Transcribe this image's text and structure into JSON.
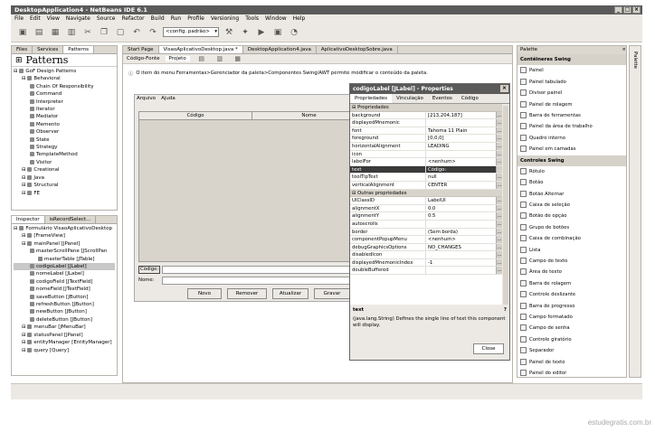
{
  "window": {
    "title": "DesktopApplication4 - NetBeans IDE 6.1",
    "controls": [
      "_",
      "□",
      "×"
    ]
  },
  "menu": [
    "File",
    "Edit",
    "View",
    "Navigate",
    "Source",
    "Refactor",
    "Build",
    "Run",
    "Profile",
    "Versioning",
    "Tools",
    "Window",
    "Help"
  ],
  "toolbar": {
    "config": "<config. padrão>"
  },
  "left_top": {
    "tabs": [
      "Files",
      "Services",
      "Patterns"
    ],
    "header": "Patterns",
    "tree": [
      {
        "t": "GoF Design Patterns",
        "d": 0
      },
      {
        "t": "Behavioral",
        "d": 1
      },
      {
        "t": "Chain Of Responsibility",
        "d": 2
      },
      {
        "t": "Command",
        "d": 2
      },
      {
        "t": "Interpreter",
        "d": 2
      },
      {
        "t": "Iterator",
        "d": 2
      },
      {
        "t": "Mediator",
        "d": 2
      },
      {
        "t": "Memento",
        "d": 2
      },
      {
        "t": "Observer",
        "d": 2
      },
      {
        "t": "State",
        "d": 2
      },
      {
        "t": "Strategy",
        "d": 2
      },
      {
        "t": "TemplateMethod",
        "d": 2
      },
      {
        "t": "Visitor",
        "d": 2
      },
      {
        "t": "Creational",
        "d": 1
      },
      {
        "t": "Java",
        "d": 1
      },
      {
        "t": "Structural",
        "d": 1
      },
      {
        "t": "FE",
        "d": 1
      }
    ]
  },
  "left_bottom": {
    "tabs": [
      "Inspector",
      "isRecordSelect..."
    ],
    "tree": [
      {
        "t": "Formulário VisaoAplicativoDesktop",
        "d": 0
      },
      {
        "t": "[FrameView]",
        "d": 1
      },
      {
        "t": "mainPanel [JPanel]",
        "d": 1
      },
      {
        "t": "masterScrollPane [JScrollPan",
        "d": 2
      },
      {
        "t": "masterTable [JTable]",
        "d": 3
      },
      {
        "t": "codigoLabel [JLabel]",
        "d": 2
      },
      {
        "t": "nomeLabel [JLabel]",
        "d": 2
      },
      {
        "t": "codigoField [JTextField]",
        "d": 2
      },
      {
        "t": "nomeField [JTextField]",
        "d": 2
      },
      {
        "t": "saveButton [JButton]",
        "d": 2
      },
      {
        "t": "refreshButton [JButton]",
        "d": 2
      },
      {
        "t": "newButton [JButton]",
        "d": 2
      },
      {
        "t": "deleteButton [JButton]",
        "d": 2
      },
      {
        "t": "menuBar [JMenuBar]",
        "d": 1
      },
      {
        "t": "statusPanel [JPanel]",
        "d": 1
      },
      {
        "t": "entityManager [EntityManager]",
        "d": 1
      },
      {
        "t": "query [Query]",
        "d": 1
      }
    ]
  },
  "editor": {
    "tabs": [
      "Start Page",
      "VisaoAplicativoDesktop.java *",
      "DesktopApplication4.java",
      "AplicativoDesktopSobre.java"
    ],
    "subtabs": [
      "Código-Fonte",
      "Projeto"
    ],
    "hint": "O item do menu Ferramentas>Gerenciador da paleta>Componentes Swing/AWT permite modificar o conteúdo da paleta.",
    "form_menu": [
      "Arquivo",
      "Ajuda"
    ],
    "columns": [
      "Código",
      "Nome"
    ],
    "codigo_label": "Código:",
    "nome_label": "Nome:",
    "buttons": [
      "Novo",
      "Remover",
      "Atualizar",
      "Gravar"
    ]
  },
  "props": {
    "title": "codigoLabel [JLabel] - Properties",
    "tabs": [
      "Propriedades",
      "Vinculação",
      "Eventos",
      "Código"
    ],
    "section1": "Propriedades",
    "rows1": [
      {
        "k": "background",
        "v": "[213,204,187]"
      },
      {
        "k": "displayedMnemonic",
        "v": ""
      },
      {
        "k": "font",
        "v": "Tahoma 11 Plain"
      },
      {
        "k": "foreground",
        "v": "[0,0,0]"
      },
      {
        "k": "horizontalAlignment",
        "v": "LEADING"
      },
      {
        "k": "icon",
        "v": ""
      },
      {
        "k": "labelFor",
        "v": "<nenhum>"
      },
      {
        "k": "text",
        "v": "Código:",
        "sel": true
      },
      {
        "k": "toolTipText",
        "v": "null"
      },
      {
        "k": "verticalAlignment",
        "v": "CENTER"
      }
    ],
    "section2": "Outras propriedades",
    "rows2": [
      {
        "k": "UIClassID",
        "v": "LabelUI"
      },
      {
        "k": "alignmentX",
        "v": "0.0"
      },
      {
        "k": "alignmentY",
        "v": "0.5"
      },
      {
        "k": "autoscrolls",
        "v": ""
      },
      {
        "k": "border",
        "v": "(Sem borda)"
      },
      {
        "k": "componentPopupMenu",
        "v": "<nenhum>"
      },
      {
        "k": "debugGraphicsOptions",
        "v": "NO_CHANGES"
      },
      {
        "k": "disabledIcon",
        "v": ""
      },
      {
        "k": "displayedMnemonicIndex",
        "v": "-1"
      },
      {
        "k": "doubleBuffered",
        "v": ""
      }
    ],
    "desc_title": "text",
    "desc": "(java.lang.String) Defines the single line of text this component will display.",
    "close": "Close"
  },
  "palette": {
    "title": "Palette",
    "sections": [
      {
        "h": "Contêineres Swing",
        "items": [
          "Painel",
          "Painel tabulado",
          "Divisor painel",
          "Painel de rolagem",
          "Barra de ferramentas",
          "Painel da área de trabalho",
          "Quadro interno",
          "Painel em camadas"
        ]
      },
      {
        "h": "Controles Swing",
        "items": [
          "Rótulo",
          "Botão",
          "Botão Alternar",
          "Caixa de seleção",
          "Botão de opção",
          "Grupo de botões",
          "Caixa de combinação",
          "Lista",
          "Campo de texto",
          "Área de texto",
          "Barra de rolagem",
          "Controle deslizante",
          "Barra de progresso",
          "Campo formatado",
          "Campo de senha",
          "Controle giratório",
          "Separador",
          "Painel de texto",
          "Painel do editor"
        ]
      }
    ],
    "side": "Palette"
  },
  "watermark": "estudegratis.com.br"
}
